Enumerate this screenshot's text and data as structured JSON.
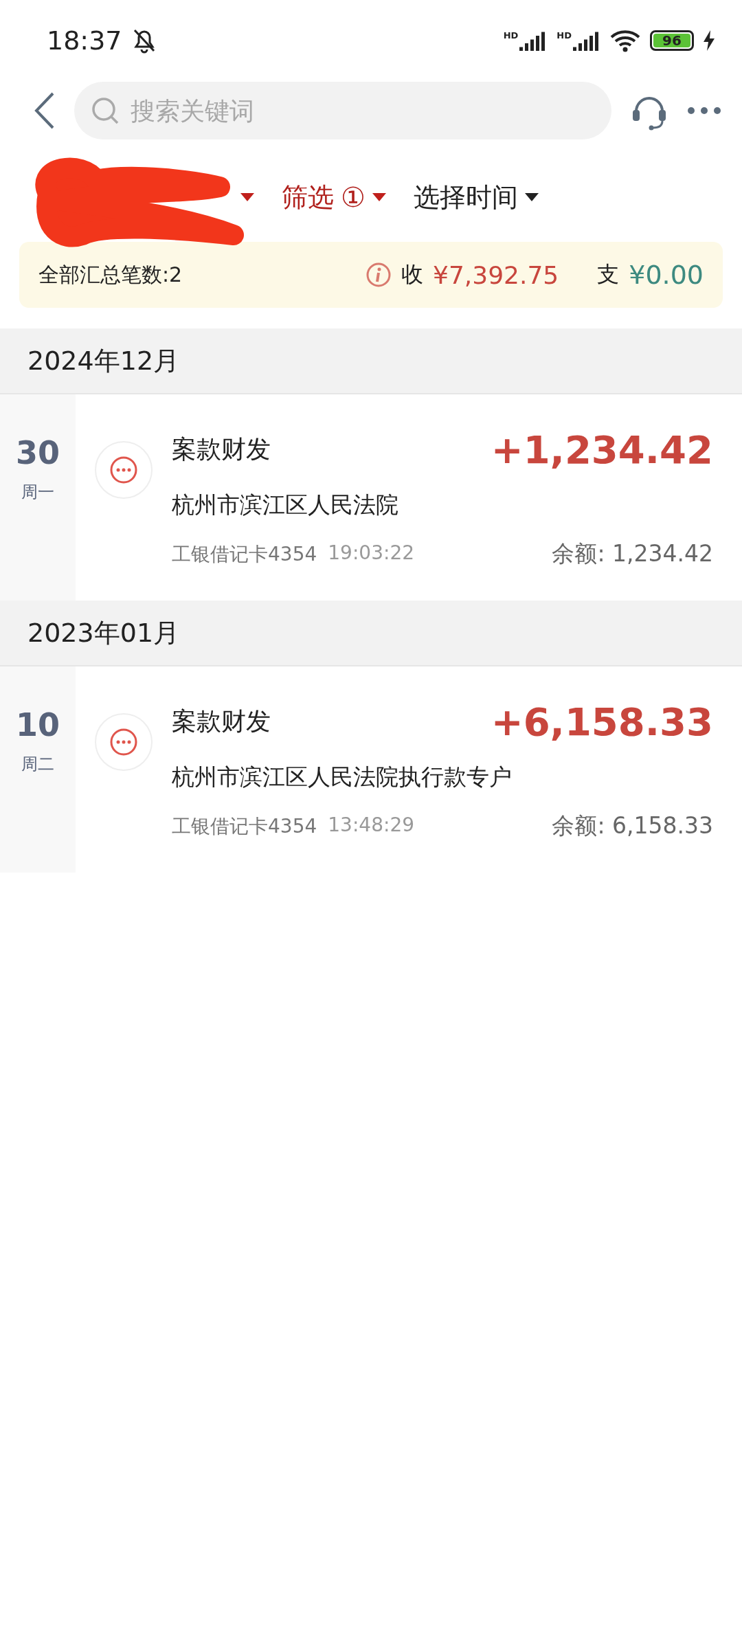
{
  "status_bar": {
    "time": "18:37",
    "battery": "96",
    "networks": [
      "HD",
      "HD"
    ]
  },
  "search": {
    "placeholder": "搜索关键词"
  },
  "filters": [
    {
      "kind": "redacted"
    },
    {
      "kind": "menu",
      "label": "筛选",
      "badge": "①",
      "active": true
    },
    {
      "kind": "menu",
      "label": "选择时间",
      "active": false
    }
  ],
  "summary": {
    "count": "全部汇总笔数:2",
    "income_label": "收",
    "income": "¥7,392.75",
    "expense_label": "支",
    "expense": "¥0.00"
  },
  "groups": [
    {
      "month": "2024年12月",
      "items": [
        {
          "day": "30",
          "weekday": "周一",
          "title": "案款财发",
          "amount": "+1,234.42",
          "counterparty": "杭州市滨江区人民法院",
          "card": "工银借记卡4354",
          "time": "19:03:22",
          "balance": "余额: 1,234.42"
        }
      ]
    },
    {
      "month": "2023年01月",
      "items": [
        {
          "day": "10",
          "weekday": "周二",
          "title": "案款财发",
          "amount": "+6,158.33",
          "counterparty": "杭州市滨江区人民法院执行款专户",
          "card": "工银借记卡4354",
          "time": "13:48:29",
          "balance": "余额: 6,158.33"
        }
      ]
    }
  ]
}
